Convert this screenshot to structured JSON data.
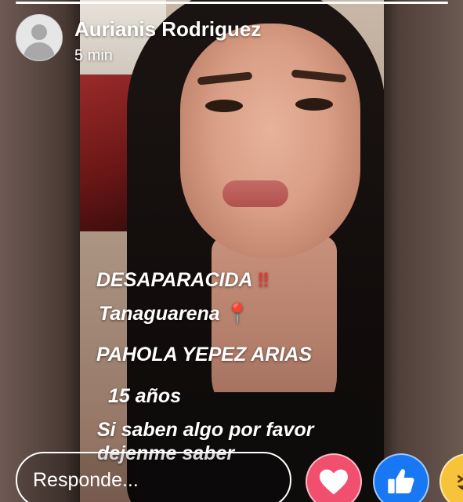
{
  "story": {
    "progress": 1.0,
    "author": "Aurianis Rodriguez",
    "timestamp": "5 min"
  },
  "overlay": {
    "line1": "DESAPARACIDA",
    "line1_mark": "‼",
    "line2": "Tanaguarena",
    "line2_mark": "📍",
    "line3": "PAHOLA YEPEZ ARIAS",
    "line4": "15 años",
    "line5": "Si saben algo por favor",
    "line6": "dejenme saber"
  },
  "reply": {
    "placeholder": "Responde..."
  },
  "reactions": [
    {
      "name": "love",
      "color": "#f0506e",
      "icon": "heart-icon"
    },
    {
      "name": "like",
      "color": "#1877f2",
      "icon": "thumbs-up-icon"
    },
    {
      "name": "haha",
      "color": "#f7c33a",
      "icon": "laughing-face-icon"
    }
  ]
}
